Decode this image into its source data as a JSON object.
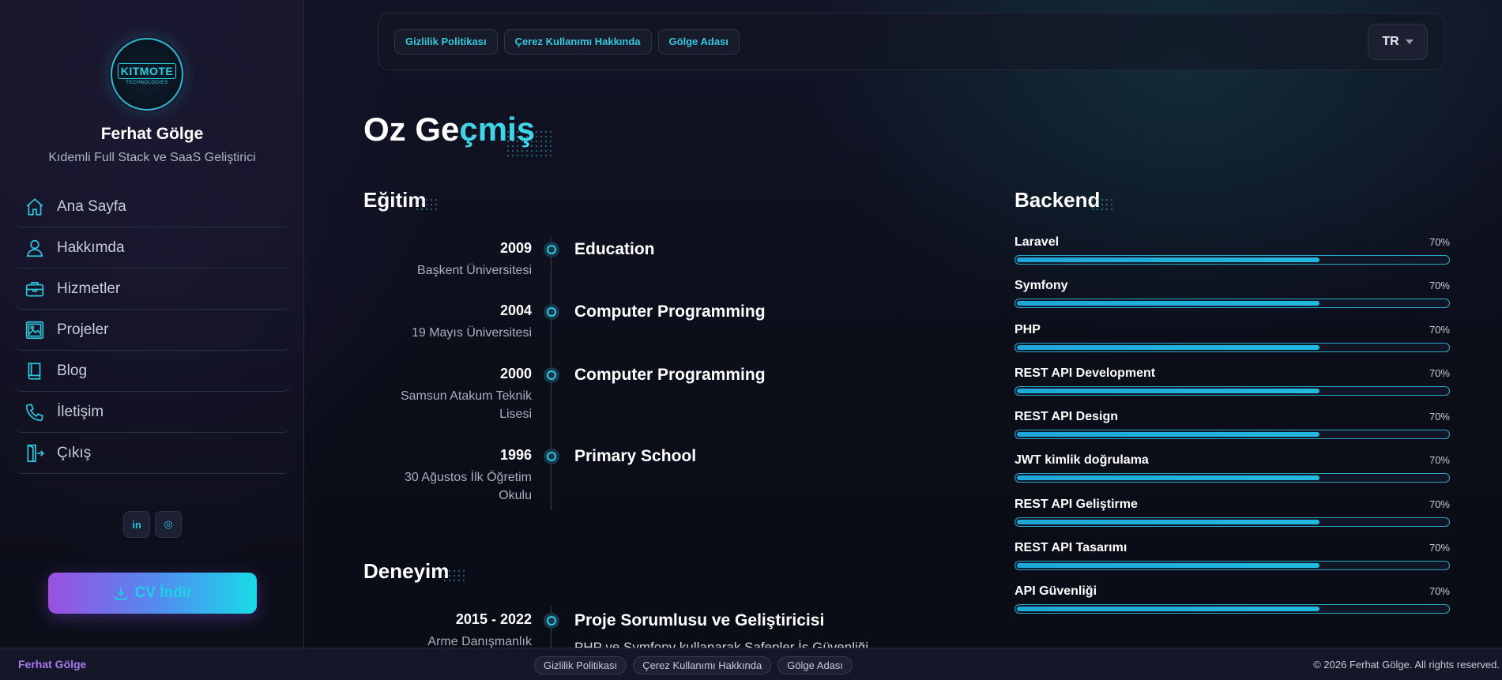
{
  "profile": {
    "logo_text": "KITMOTE",
    "logo_subtext": "TECHNOLOGIES",
    "name": "Ferhat Gölge",
    "title": "Kıdemli Full Stack ve SaaS Geliştirici"
  },
  "sidebar": {
    "items": [
      {
        "label": "Ana Sayfa",
        "icon": "home-icon"
      },
      {
        "label": "Hakkımda",
        "icon": "user-icon"
      },
      {
        "label": "Hizmetler",
        "icon": "briefcase-icon"
      },
      {
        "label": "Projeler",
        "icon": "image-icon"
      },
      {
        "label": "Blog",
        "icon": "book-icon"
      },
      {
        "label": "İletişim",
        "icon": "phone-icon"
      },
      {
        "label": "Çıkış",
        "icon": "logout-icon"
      }
    ],
    "socials": [
      {
        "label": "in",
        "icon": "linkedin-icon"
      },
      {
        "label": "◎",
        "icon": "instagram-icon"
      }
    ],
    "cv_button": "CV İndir"
  },
  "topbar": {
    "links": [
      "Gizlilik Politikası",
      "Çerez Kullanımı Hakkında",
      "Gölge Adası"
    ],
    "language": "TR"
  },
  "page": {
    "title_part1": "Oz Ge",
    "title_part2": "çmiş"
  },
  "education": {
    "heading": "Eğitim",
    "entries": [
      {
        "year": "2009",
        "institution": "Başkent Üniversitesi",
        "title": "Education"
      },
      {
        "year": "2004",
        "institution": "19 Mayıs Üniversitesi",
        "title": "Computer Programming"
      },
      {
        "year": "2000",
        "institution": "Samsun Atakum Teknik Lisesi",
        "title": "Computer Programming"
      },
      {
        "year": "1996",
        "institution": "30 Ağustos İlk Öğretim Okulu",
        "title": "Primary School"
      }
    ]
  },
  "experience": {
    "heading": "Deneyim",
    "entries": [
      {
        "year": "2015 - 2022",
        "institution": "Arme Danışmanlık",
        "title": "Proje Sorumlusu ve Geliştiricisi",
        "description": "PHP ve Symfony kullanarak Şafepler İş Güvenliği"
      }
    ]
  },
  "skills": {
    "heading": "Backend",
    "items": [
      {
        "name": "Laravel",
        "percent_label": "70%",
        "level": 0.7
      },
      {
        "name": "Symfony",
        "percent_label": "70%",
        "level": 0.7
      },
      {
        "name": "PHP",
        "percent_label": "70%",
        "level": 0.7
      },
      {
        "name": "REST API Development",
        "percent_label": "70%",
        "level": 0.7
      },
      {
        "name": "REST API Design",
        "percent_label": "70%",
        "level": 0.7
      },
      {
        "name": "JWT kimlik doğrulama",
        "percent_label": "70%",
        "level": 0.7
      },
      {
        "name": "REST API Geliştirme",
        "percent_label": "70%",
        "level": 0.7
      },
      {
        "name": "REST API Tasarımı",
        "percent_label": "70%",
        "level": 0.7
      },
      {
        "name": "API Güvenliği",
        "percent_label": "70%",
        "level": 0.7
      }
    ]
  },
  "footer": {
    "brand": "Ferhat Gölge",
    "links": [
      "Gizlilik Politikası",
      "Çerez Kullanımı Hakkında",
      "Gölge Adası"
    ],
    "copyright": "© 2026 Ferhat Gölge. All rights reserved."
  },
  "colors": {
    "accent": "#3fd4e6",
    "background": "#0d0f1a",
    "brand_purple": "#a879f2"
  }
}
